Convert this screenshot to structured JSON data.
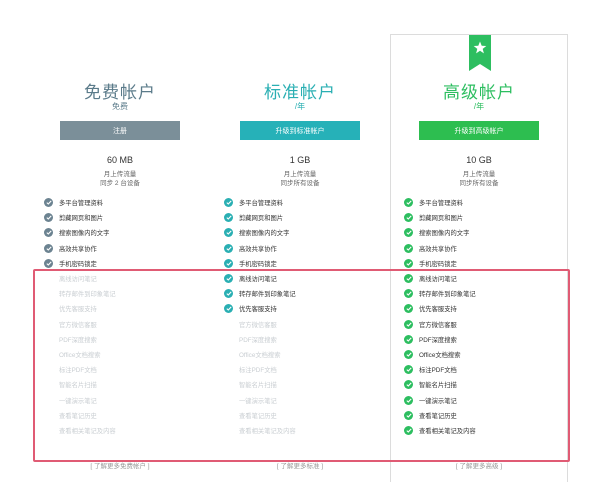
{
  "plans": [
    {
      "title": "免费帐户",
      "subtitle": "免费",
      "button": "注册",
      "storage": "60 MB",
      "notes": [
        "月上传流量",
        "同步 2 台设备"
      ],
      "features": [
        {
          "label": "多平台管理资料",
          "on": true
        },
        {
          "label": "剪藏网页和图片",
          "on": true
        },
        {
          "label": "搜索图像内的文字",
          "on": true
        },
        {
          "label": "高效共享协作",
          "on": true
        },
        {
          "label": "手机密码锁定",
          "on": true
        },
        {
          "label": "离线访问笔记",
          "on": false
        },
        {
          "label": "转存邮件到印象笔记",
          "on": false
        },
        {
          "label": "优先客服支持",
          "on": false
        },
        {
          "label": "官方微信客服",
          "on": false
        },
        {
          "label": "PDF深度搜索",
          "on": false
        },
        {
          "label": "Office文档搜索",
          "on": false
        },
        {
          "label": "标注PDF文档",
          "on": false
        },
        {
          "label": "智能名片扫描",
          "on": false
        },
        {
          "label": "一键演示笔记",
          "on": false
        },
        {
          "label": "查看笔记历史",
          "on": false
        },
        {
          "label": "查看相关笔记及内容",
          "on": false
        }
      ],
      "more": "了解更多免费帐户"
    },
    {
      "title": "标准帐户",
      "subtitle": "/年",
      "button": "升级到标准帐户",
      "storage": "1 GB",
      "notes": [
        "月上传流量",
        "同步所有设备"
      ],
      "features": [
        {
          "label": "多平台管理资料",
          "on": true
        },
        {
          "label": "剪藏网页和图片",
          "on": true
        },
        {
          "label": "搜索图像内的文字",
          "on": true
        },
        {
          "label": "高效共享协作",
          "on": true
        },
        {
          "label": "手机密码锁定",
          "on": true
        },
        {
          "label": "离线访问笔记",
          "on": true
        },
        {
          "label": "转存邮件到印象笔记",
          "on": true
        },
        {
          "label": "优先客服支持",
          "on": true
        },
        {
          "label": "官方微信客服",
          "on": false
        },
        {
          "label": "PDF深度搜索",
          "on": false
        },
        {
          "label": "Office文档搜索",
          "on": false
        },
        {
          "label": "标注PDF文档",
          "on": false
        },
        {
          "label": "智能名片扫描",
          "on": false
        },
        {
          "label": "一键演示笔记",
          "on": false
        },
        {
          "label": "查看笔记历史",
          "on": false
        },
        {
          "label": "查看相关笔记及内容",
          "on": false
        }
      ],
      "more": "了解更多标准"
    },
    {
      "title": "高级帐户",
      "subtitle": "/年",
      "button": "升级到高级帐户",
      "storage": "10 GB",
      "notes": [
        "月上传流量",
        "同步所有设备"
      ],
      "features": [
        {
          "label": "多平台管理资料",
          "on": true
        },
        {
          "label": "剪藏网页和图片",
          "on": true
        },
        {
          "label": "搜索图像内的文字",
          "on": true
        },
        {
          "label": "高效共享协作",
          "on": true
        },
        {
          "label": "手机密码锁定",
          "on": true
        },
        {
          "label": "离线访问笔记",
          "on": true
        },
        {
          "label": "转存邮件到印象笔记",
          "on": true
        },
        {
          "label": "优先客服支持",
          "on": true
        },
        {
          "label": "官方微信客服",
          "on": true
        },
        {
          "label": "PDF深度搜索",
          "on": true
        },
        {
          "label": "Office文档搜索",
          "on": true
        },
        {
          "label": "标注PDF文档",
          "on": true
        },
        {
          "label": "智能名片扫描",
          "on": true
        },
        {
          "label": "一键演示笔记",
          "on": true
        },
        {
          "label": "查看笔记历史",
          "on": true
        },
        {
          "label": "查看相关笔记及内容",
          "on": true
        }
      ],
      "more": "了解更多高级"
    }
  ],
  "ribbon_icon": "star-icon",
  "colors": {
    "free": "#6c8391",
    "standard": "#2aafb3",
    "premium": "#2dbe60",
    "highlight": "#e05b74"
  }
}
